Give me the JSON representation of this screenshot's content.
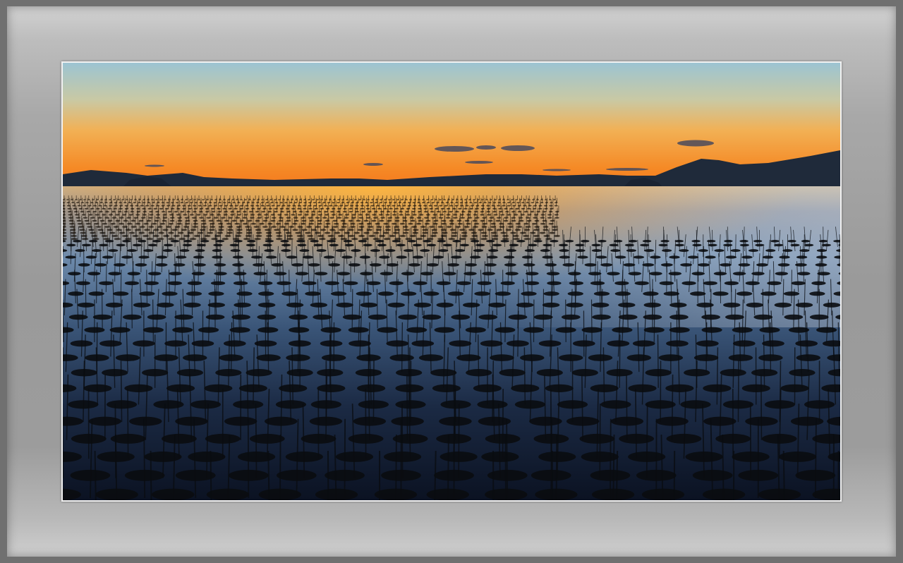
{
  "image": {
    "subject": "sunset-over-seaweed-farm",
    "colors": {
      "sky_top": "#9cc2cf",
      "sky_mid": "#f2a640",
      "sky_horizon": "#f57c1c",
      "mountains": "#1e2a3c",
      "water_top": "#b9b6a6",
      "water_mid": "#4a6a90",
      "water_bottom": "#0c1426",
      "reflection": "#f0a030",
      "seaweed": "#0a0c10"
    }
  }
}
